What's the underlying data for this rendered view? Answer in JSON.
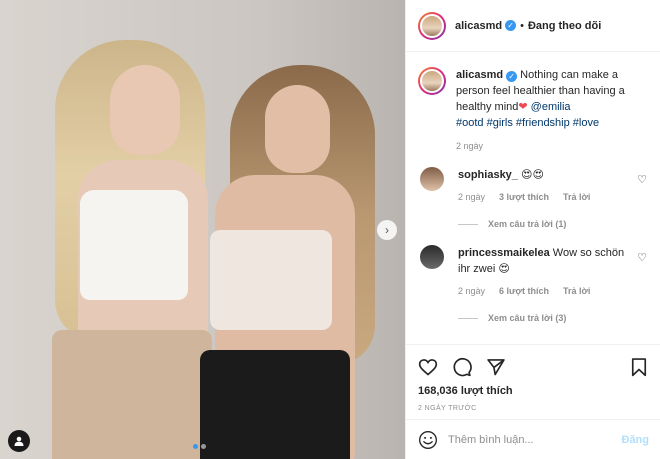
{
  "post": {
    "username": "alicasmd",
    "separator": "•",
    "follow_status": "Đang theo dõi"
  },
  "caption": {
    "username": "alicasmd",
    "text": "Nothing can make a person feel healthier than having a healthy mind",
    "heart": "❤",
    "mention": "@emilia",
    "hashtags": "#ootd #girls #friendship #love",
    "age": "2 ngày"
  },
  "comments": [
    {
      "username": "sophiasky_",
      "text": "😍😍",
      "age": "2 ngày",
      "likes": "3 lượt thích",
      "reply": "Trả lời",
      "view_replies": "Xem câu trả lời (1)"
    },
    {
      "username": "princessmaikelea",
      "text": "Wow so schön ihr zwei 😍",
      "age": "2 ngày",
      "likes": "6 lượt thích",
      "reply": "Trả lời",
      "view_replies": "Xem câu trả lời (3)"
    }
  ],
  "stats": {
    "likes": "168,036 lượt thích",
    "date": "2 NGÀY TRƯỚC"
  },
  "composer": {
    "placeholder": "Thêm bình luận...",
    "post_label": "Đăng"
  },
  "colors": {
    "accent": "#3897f0",
    "heart": "#ed4956",
    "link": "#00376b",
    "post_disabled": "#b2dffc"
  },
  "icons": {
    "like": "heart-icon",
    "comment": "comment-icon",
    "share": "share-icon",
    "save": "bookmark-icon",
    "emoji": "emoji-icon",
    "next": "chevron-right-icon",
    "tag": "user-tag-icon"
  }
}
